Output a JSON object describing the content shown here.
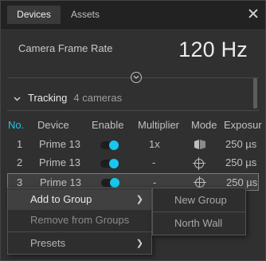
{
  "tabs": [
    {
      "label": "Devices",
      "active": true
    },
    {
      "label": "Assets",
      "active": false
    }
  ],
  "frame_rate": {
    "label": "Camera Frame Rate",
    "value": "120 Hz"
  },
  "tracking": {
    "title": "Tracking",
    "count": "4 cameras"
  },
  "table": {
    "headers": {
      "no": "No.",
      "device": "Device",
      "enable": "Enable",
      "multiplier": "Multiplier",
      "mode": "Mode",
      "exposure": "Exposur"
    },
    "rows": [
      {
        "no": "1",
        "device": "Prime 13",
        "enabled": true,
        "multiplier": "1x",
        "mode_icon": "camera-mode-icon",
        "exposure": "250 µs"
      },
      {
        "no": "2",
        "device": "Prime 13",
        "enabled": true,
        "multiplier": "-",
        "mode_icon": "crosshair-mode-icon",
        "exposure": "250 µs"
      },
      {
        "no": "3",
        "device": "Prime 13",
        "enabled": true,
        "multiplier": "-",
        "mode_icon": "crosshair-mode-icon",
        "exposure": "250 µs"
      }
    ]
  },
  "context_menu": {
    "items": [
      {
        "label": "Add to Group",
        "has_submenu": true,
        "highlighted": true
      },
      {
        "label": "Remove from Groups",
        "has_submenu": false,
        "disabled": true
      },
      {
        "label": "Presets",
        "has_submenu": true
      }
    ],
    "submenu": [
      {
        "label": "New Group"
      },
      {
        "label": "North Wall"
      }
    ]
  },
  "colors": {
    "accent": "#19c7ee",
    "header_no": "#22c4e8",
    "background": "#303030"
  }
}
